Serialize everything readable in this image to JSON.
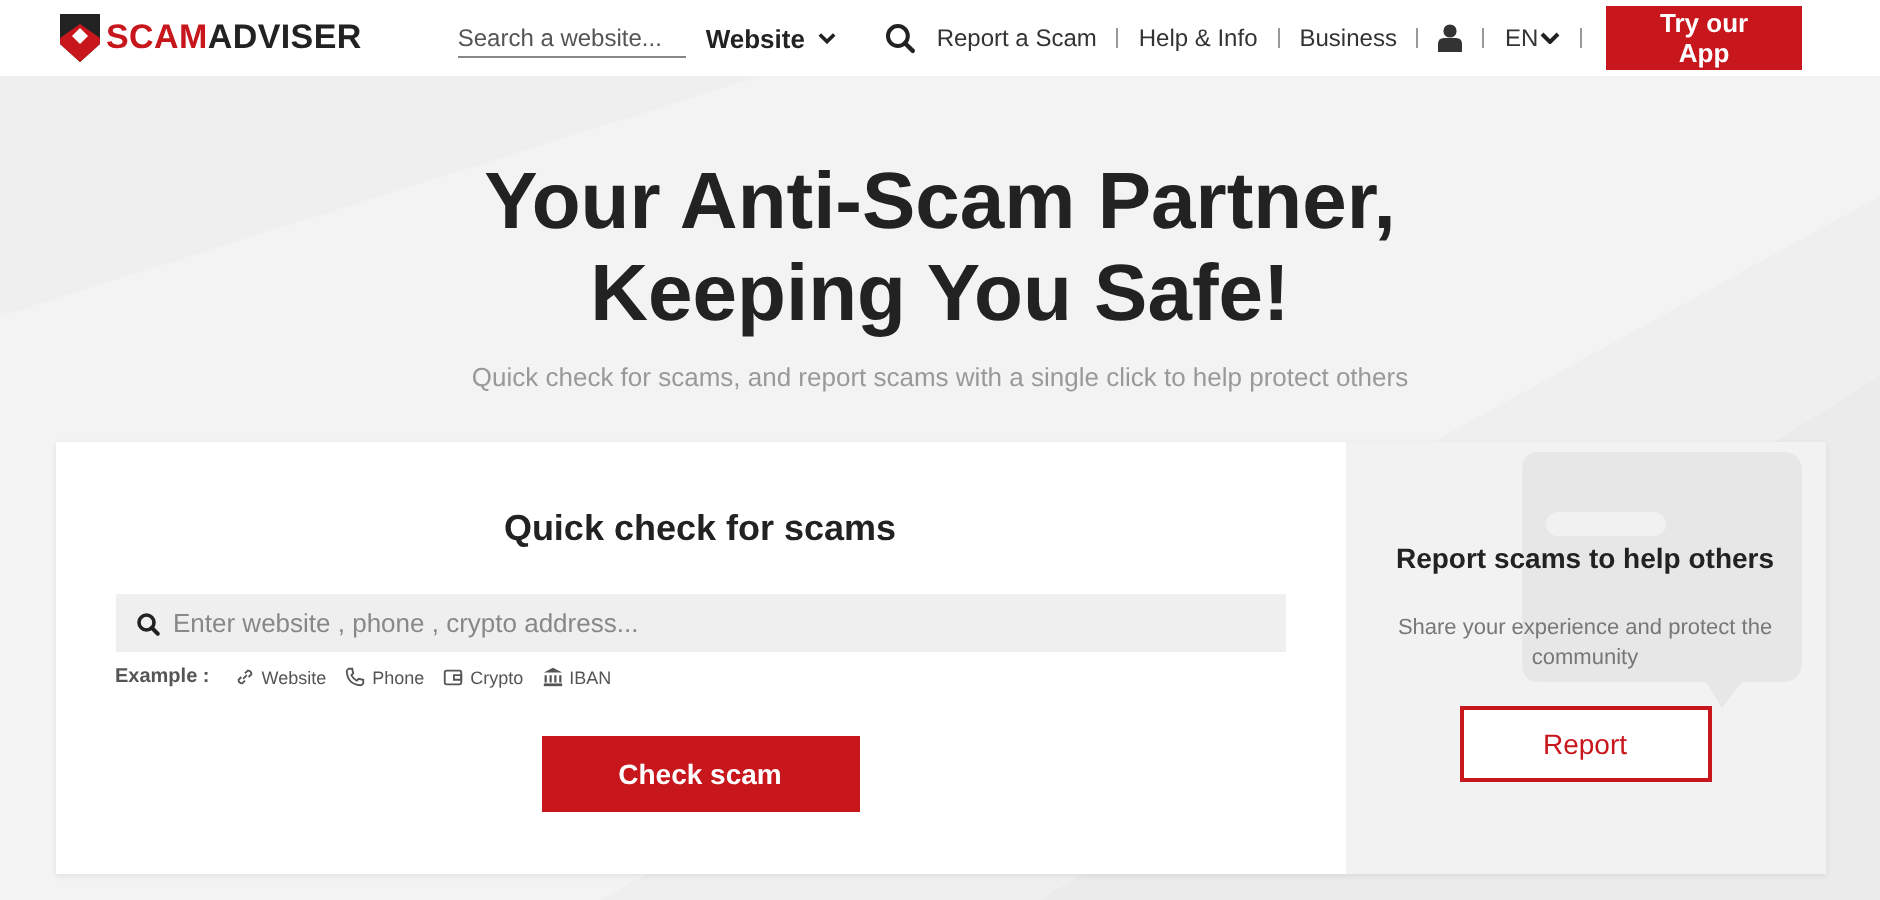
{
  "header": {
    "logo": [
      "SCAM",
      "ADVISER"
    ],
    "search": {
      "placeholder": "Search a website..."
    },
    "search_type": "Website",
    "nav": [
      {
        "kind": "link",
        "label": "Report a Scam"
      },
      {
        "kind": "link",
        "label": "Help & Info"
      },
      {
        "kind": "link",
        "label": "Business"
      },
      {
        "kind": "account"
      },
      {
        "kind": "language",
        "label": "EN"
      }
    ],
    "app_button": "Try our App"
  },
  "hero": {
    "title": "Your Anti-Scam Partner,\nKeeping You Safe!",
    "subtitle": "Quick check for scams, and report scams with a single click to help protect others"
  },
  "check": {
    "title": "Quick check for scams",
    "search": {
      "placeholder": "Enter website , phone , crypto address..."
    },
    "example_label": "Example :",
    "examples": [
      {
        "kind": "website",
        "label": "Website"
      },
      {
        "kind": "phone",
        "label": "Phone"
      },
      {
        "kind": "crypto",
        "label": "Crypto"
      },
      {
        "kind": "iban",
        "label": "IBAN"
      }
    ],
    "button": "Check scam"
  },
  "report": {
    "title": "Report scams to help others",
    "text": "Share your experience and protect the community",
    "button": "Report"
  }
}
